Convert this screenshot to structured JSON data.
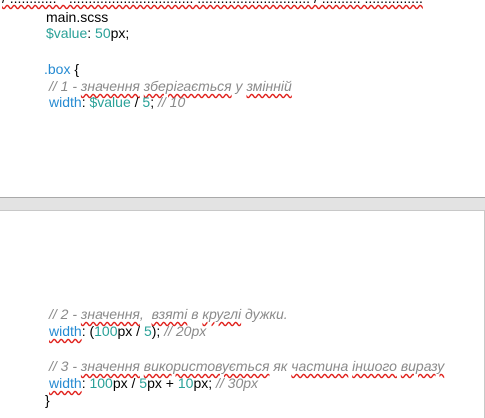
{
  "document": {
    "top_cut_line": "/ ............ - ................................ ............................. / .......... ...............",
    "filename": "main.scss",
    "var_decl": {
      "name": "$value",
      "colon": ": ",
      "number": "50",
      "unit": "px",
      "semi": ";"
    },
    "selector": {
      "name": ".box",
      "open": " {"
    },
    "comment1": {
      "prefix": "// 1 - ",
      "w1": "значення",
      "sp1": " ",
      "w2": "зберігається",
      "mid": " у ",
      "w3": "змінній"
    },
    "width1": {
      "prop": "width",
      "colon": ": ",
      "var": "$value",
      "op": " / ",
      "num": "5",
      "semi": ";",
      "comment": " // 10"
    },
    "comment2": {
      "prefix": "// 2 - ",
      "w1": "значення",
      "sp": ",  ",
      "w2": "взяті",
      "mid": " в ",
      "w3": "круглі",
      "rest": " дужки."
    },
    "width2": {
      "prop": "width",
      "colon": ": (",
      "n1": "100",
      "u1": "px",
      "op": " / ",
      "n2": "5",
      "close": ");",
      "comment": " // 20px"
    },
    "comment3": {
      "prefix": "// 3 - ",
      "w1": "значення",
      "sp": " ",
      "w2": "використовується",
      "mid": " як ",
      "w3": "частина",
      "sp2": " ",
      "w4": "іншого",
      "sp3": " ",
      "w5": "виразу"
    },
    "width3": {
      "prop": "width",
      "colon": ": ",
      "n1": "100",
      "u1": "px",
      "op1": " / ",
      "n2": "5",
      "u2": "px",
      "op2": " + ",
      "n3": "10",
      "u3": "px",
      "semi": ";",
      "comment": " // 30px"
    },
    "close_brace": "}"
  }
}
